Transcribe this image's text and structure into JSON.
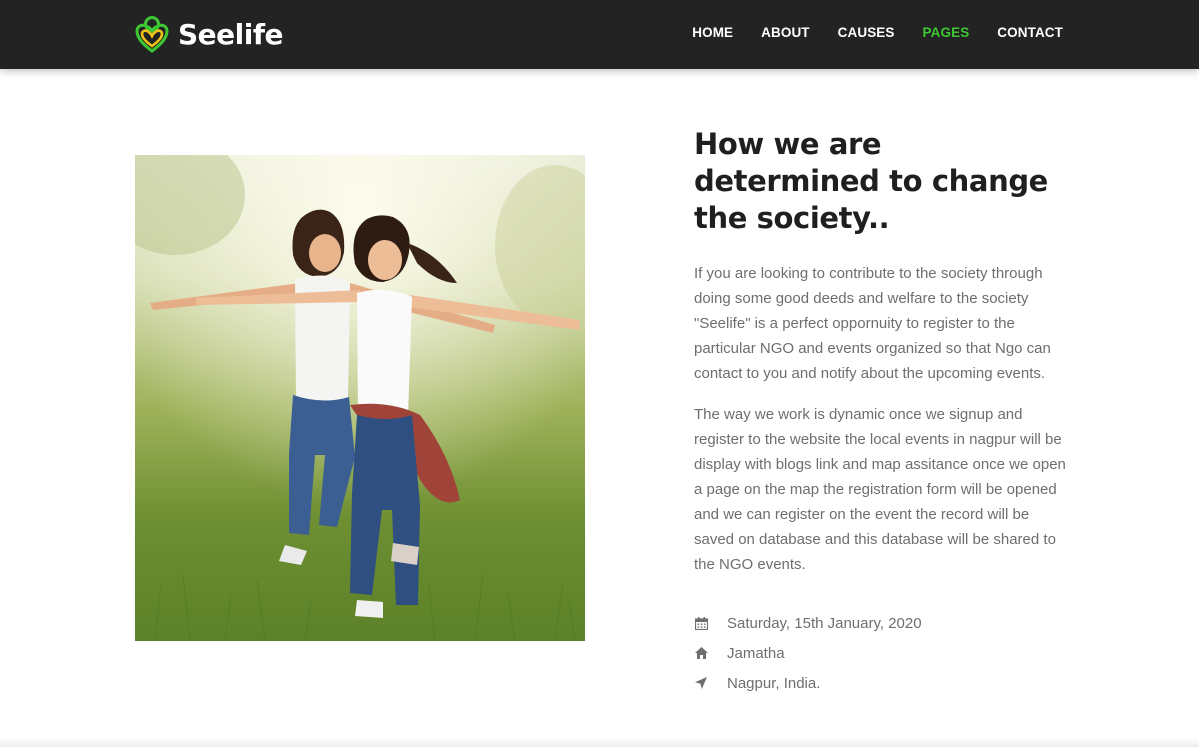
{
  "brand": {
    "name": "Seelife",
    "accent": "#3ec733",
    "logo_accent": "#f2c21b"
  },
  "nav": {
    "items": [
      {
        "label": "HOME",
        "active": false
      },
      {
        "label": "ABOUT",
        "active": false
      },
      {
        "label": "CAUSES",
        "active": false
      },
      {
        "label": "PAGES",
        "active": true
      },
      {
        "label": "CONTACT",
        "active": false
      }
    ]
  },
  "main": {
    "image_icon": "photo-two-girls-running",
    "heading": "How we are determined to change the society..",
    "paragraph1": "If you are looking to contribute to the society through doing some good deeds and welfare to the society \"Seelife\" is a perfect oppornuity to register to the particular NGO and events organized so that Ngo can contact to you and notify about the upcoming events.",
    "paragraph2": "The way we work is dynamic once we signup and register to the website the local events in nagpur will be display with blogs link and map assitance once we open a page on the map the registration form will be opened and we can register on the event the record will be saved on database and this database will be shared to the NGO events.",
    "details": [
      {
        "icon": "calendar-icon",
        "text": "Saturday, 15th January, 2020"
      },
      {
        "icon": "home-icon",
        "text": "Jamatha"
      },
      {
        "icon": "location-arrow-icon",
        "text": "Nagpur, India."
      }
    ]
  }
}
